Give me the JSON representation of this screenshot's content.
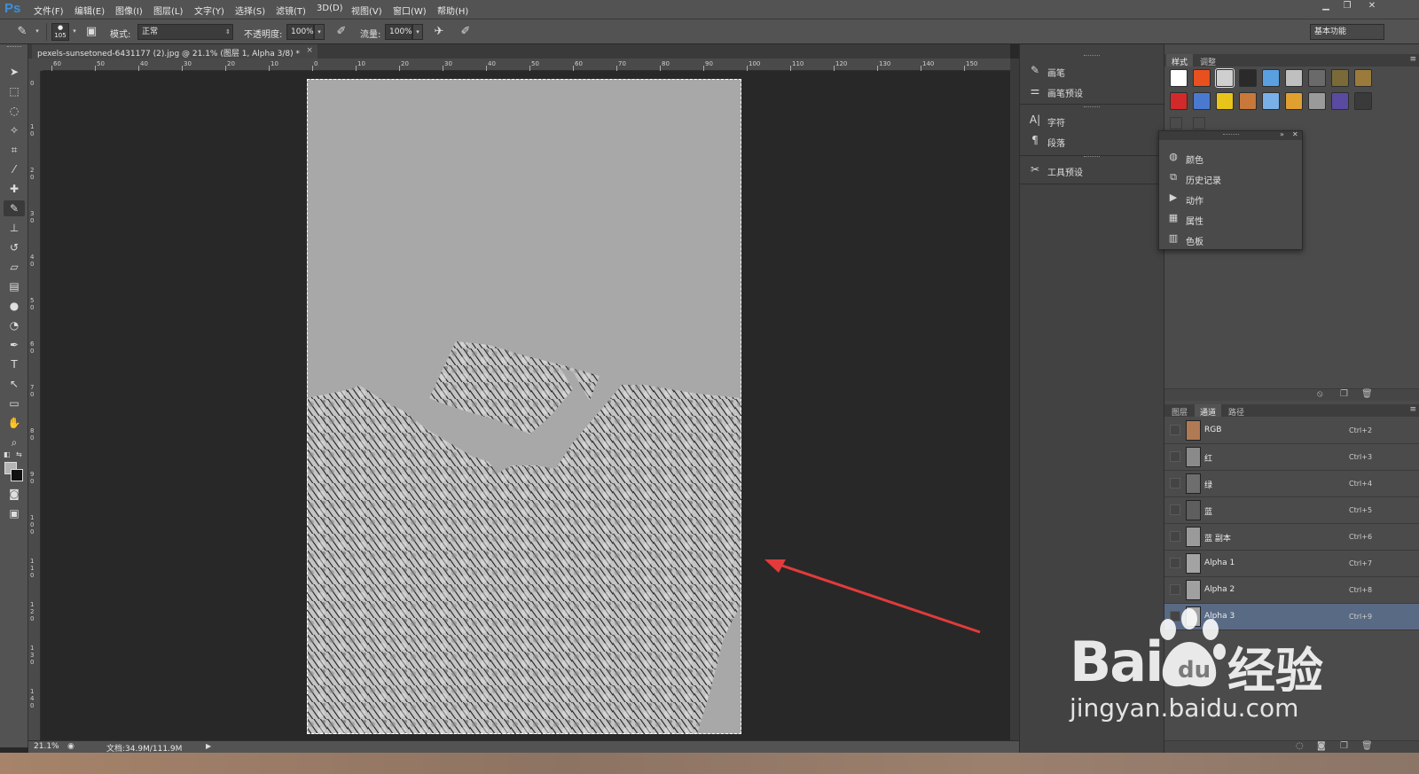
{
  "app": {
    "logo": "Ps",
    "menu": [
      "文件(F)",
      "编辑(E)",
      "图像(I)",
      "图层(L)",
      "文字(Y)",
      "选择(S)",
      "滤镜(T)",
      "3D(D)",
      "视图(V)",
      "窗口(W)",
      "帮助(H)"
    ],
    "window_controls": [
      "minimize-icon",
      "restore-icon",
      "close-icon"
    ]
  },
  "options": {
    "brush_size": "105",
    "mode_label": "模式:",
    "mode_value": "正常",
    "opacity_label": "不透明度:",
    "opacity_value": "100%",
    "flow_label": "流量:",
    "flow_value": "100%",
    "workspace": "基本功能"
  },
  "document": {
    "tab_title": "pexels-sunsetoned-6431177 (2).jpg @ 21.1% (图层 1, Alpha 3/8) *",
    "tab_close": "×",
    "ruler_h": [
      "60",
      "50",
      "40",
      "30",
      "20",
      "10",
      "0",
      "10",
      "20",
      "30",
      "40",
      "50",
      "60",
      "70",
      "80",
      "90",
      "100",
      "110",
      "120",
      "130",
      "140",
      "150"
    ],
    "ruler_v": [
      "0",
      "10",
      "20",
      "30",
      "40",
      "50",
      "60",
      "70",
      "80",
      "90",
      "100",
      "110",
      "120",
      "130",
      "140"
    ],
    "canvas_color": "#a8a8a8",
    "annotation_arrow_color": "#e23b3b"
  },
  "status": {
    "zoom": "21.1%",
    "doc_info": "文档:34.9M/111.9M"
  },
  "dock": {
    "groups": [
      [
        {
          "icon": "brush-icon",
          "label": "画笔"
        },
        {
          "icon": "brush-preset-icon",
          "label": "画笔预设"
        }
      ],
      [
        {
          "icon": "character-icon",
          "label": "字符"
        },
        {
          "icon": "paragraph-icon",
          "label": "段落"
        }
      ],
      [
        {
          "icon": "tool-preset-icon",
          "label": "工具预设"
        }
      ]
    ]
  },
  "styles_panel": {
    "tabs": [
      "样式",
      "调整"
    ],
    "swatch_colors": [
      "#ffffff",
      "#e8501f",
      "#cfcfcf",
      "#2a2a2a",
      "#5aa0e0",
      "#bfbfbf",
      "#6a6a6a",
      "#7a6a3a",
      "#9b7b3b",
      "#d22a2a",
      "#4a7ad0",
      "#e8c41a",
      "#c8783a",
      "#7ab0e8",
      "#e0a030",
      "#9a9a9a",
      "#5a4aa0",
      "#3a3a3a"
    ]
  },
  "floating_panel": {
    "items": [
      {
        "icon": "color-icon",
        "label": "颜色"
      },
      {
        "icon": "history-icon",
        "label": "历史记录"
      },
      {
        "icon": "actions-play-icon",
        "label": "动作"
      },
      {
        "icon": "properties-icon",
        "label": "属性"
      },
      {
        "icon": "swatches-icon",
        "label": "色板"
      }
    ]
  },
  "channels_panel": {
    "tabs": [
      "图层",
      "通道",
      "路径"
    ],
    "active_tab": "通道",
    "rows": [
      {
        "name": "RGB",
        "shortcut": "Ctrl+2",
        "thumb": "#b07a55"
      },
      {
        "name": "红",
        "shortcut": "Ctrl+3",
        "thumb": "#8a8a8a"
      },
      {
        "name": "绿",
        "shortcut": "Ctrl+4",
        "thumb": "#6e6e6e"
      },
      {
        "name": "蓝",
        "shortcut": "Ctrl+5",
        "thumb": "#5e5e5e"
      },
      {
        "name": "蓝 副本",
        "shortcut": "Ctrl+6",
        "thumb": "#9a9a9a"
      },
      {
        "name": "Alpha 1",
        "shortcut": "Ctrl+7",
        "thumb": "#a3a3a3"
      },
      {
        "name": "Alpha 2",
        "shortcut": "Ctrl+8",
        "thumb": "#a0a0a0"
      },
      {
        "name": "Alpha 3",
        "shortcut": "Ctrl+9",
        "thumb": "#a6a6a6",
        "selected": true
      }
    ]
  },
  "watermark": {
    "brand_left": "Bai",
    "brand_right": "经验",
    "url": "jingyan.baidu.com"
  }
}
